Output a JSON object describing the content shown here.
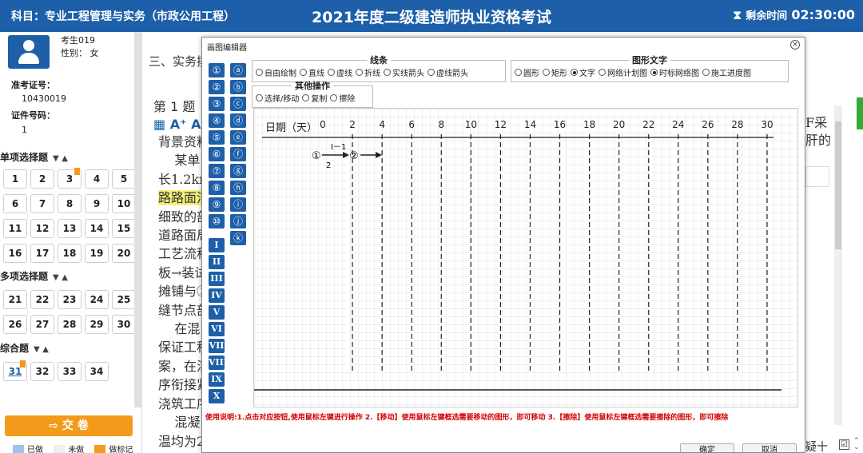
{
  "header": {
    "subject": "科目：专业工程管理与实务（市政公用工程）",
    "title": "2021年度二级建造师执业资格考试",
    "timer_label": "剩余时间",
    "timer_value": "02:30:00"
  },
  "candidate": {
    "name": "考生019",
    "gender": "性别：  女",
    "ticket_label": "准考证号：",
    "ticket_value": "10430019",
    "id_label": "证件号码：",
    "id_value": "1"
  },
  "sections": [
    {
      "title": "单项选择题",
      "questions": [
        "1",
        "2",
        "3",
        "4",
        "5",
        "6",
        "7",
        "8",
        "9",
        "10",
        "11",
        "12",
        "13",
        "14",
        "15",
        "16",
        "17",
        "18",
        "19",
        "20"
      ]
    },
    {
      "title": "多项选择题",
      "questions": [
        "21",
        "22",
        "23",
        "24",
        "25",
        "26",
        "27",
        "28",
        "29",
        "30"
      ]
    },
    {
      "title": "综合题",
      "questions": [
        "31",
        "32",
        "33",
        "34"
      ]
    }
  ],
  "submit_label": "交  卷",
  "legend": {
    "done": "已做",
    "undone": "未做",
    "marked": "做标记"
  },
  "main": {
    "section_heading": "三、实务摸",
    "question_label": "第 1 题",
    "text_size_icon": "A⁺ A",
    "lines": [
      "背景资料",
      "    某单",
      "长1.2km",
      "路路面洁",
      "细致的剖",
      "道路面局",
      "工艺流程",
      "板→装试",
      "摊铺与②",
      "缝节点部",
      "    在混",
      "保证工程",
      "案，在混",
      "序衔接紧",
      "浇筑工序",
      "    混凝",
      "温均为2"
    ],
    "highlight_line": 3,
    "right_text_1": "F采",
    "right_text_2": "肝的",
    "bottom_right": "疑十"
  },
  "dialog": {
    "title": "画图编辑器",
    "circled": [
      "①",
      "②",
      "③",
      "④",
      "⑤",
      "⑥",
      "⑦",
      "⑧",
      "⑨",
      "⑩"
    ],
    "letters": [
      "ⓐ",
      "ⓑ",
      "ⓒ",
      "ⓓ",
      "ⓔ",
      "ⓕ",
      "ⓖ",
      "ⓗ",
      "ⓘ",
      "ⓙ",
      "ⓚ"
    ],
    "romans": [
      "I",
      "II",
      "III",
      "IV",
      "V",
      "VI",
      "VII",
      "VIII",
      "IX",
      "X"
    ],
    "line_group": {
      "legend": "线条",
      "options": [
        {
          "label": "自由绘制",
          "selected": false
        },
        {
          "label": "直线",
          "selected": false
        },
        {
          "label": "虚线",
          "selected": false
        },
        {
          "label": "折线",
          "selected": false
        },
        {
          "label": "实线箭头",
          "selected": false
        },
        {
          "label": "虚线箭头",
          "selected": false
        }
      ]
    },
    "shape_group": {
      "legend": "图形文字",
      "options": [
        {
          "label": "圆形",
          "selected": false
        },
        {
          "label": "矩形",
          "selected": false
        },
        {
          "label": "文字",
          "selected": true
        },
        {
          "label": "网络计划图",
          "selected": false
        },
        {
          "label": "时标网络图",
          "selected": true
        },
        {
          "label": "施工进度图",
          "selected": false
        }
      ]
    },
    "other_group": {
      "legend": "其他操作",
      "options": [
        {
          "label": "选择/移动",
          "selected": false
        },
        {
          "label": "复制",
          "selected": false
        },
        {
          "label": "擦除",
          "selected": false
        }
      ]
    },
    "timescale": {
      "axis_label": "日期（天）",
      "ticks": [
        0,
        2,
        4,
        6,
        8,
        10,
        12,
        14,
        16,
        18,
        20,
        22,
        24,
        26,
        28,
        30
      ],
      "node1": "①",
      "node2": "②",
      "activity_name": "I－1",
      "activity_duration": "2"
    },
    "usage": "使用说明:1.点击对应按钮,使用鼠标左键进行操作    2.【移动】使用鼠标左键框选需要移动的图形，即可移动    3.【擦除】使用鼠标左键框选需要擦除的图形，即可擦除",
    "ok_label": "确定",
    "cancel_label": "取消"
  }
}
